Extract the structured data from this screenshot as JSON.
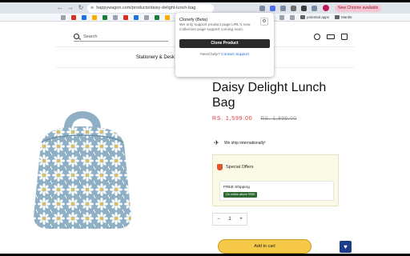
{
  "browser": {
    "url": "happywagon.com/products/daisy-delight-lunch-bag",
    "new_chrome_label": "New Chrome available",
    "bookmarks": [
      {
        "label": "potential apps"
      },
      {
        "label": "Mantle"
      }
    ]
  },
  "header": {
    "search_placeholder": "Search",
    "nav_item": "Stationery & Desk"
  },
  "popup": {
    "title": "Clonefy (Beta)",
    "text": "We only support product page URL's now. Collection page support coming soon.",
    "button": "Clone Product",
    "help_prefix": "Need help?",
    "help_link": "Contact Support"
  },
  "product": {
    "title": "Daisy Delight Lunch Bag",
    "price": "RS. 1,599.00",
    "compare_price": "RS. 1,899.00",
    "ship_text": "We ship internationally!",
    "offers_title": "Special Offers",
    "free_shipping_title": "FREE Shipping",
    "free_shipping_badge": "On orders above ₹999",
    "quantity": "1",
    "qty_minus": "−",
    "qty_plus": "+",
    "add_to_cart": "Add to cart"
  },
  "colors": {
    "price": "#e03a3a",
    "cart_button": "#f7c948",
    "wishlist": "#1f3c88",
    "bag": "#8fb0c4"
  }
}
